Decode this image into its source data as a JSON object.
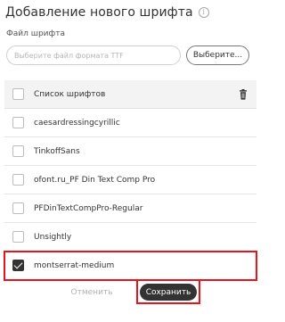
{
  "dialog": {
    "title": "Добавление нового шрифта",
    "info_icon": "ⓘ"
  },
  "file_field": {
    "label": "Файл шрифта",
    "placeholder": "Выберите файл формата TTF",
    "browse_label": "Выберите..."
  },
  "font_list": {
    "header_label": "Список шрифтов",
    "header_icon": "trash-icon",
    "items": [
      {
        "label": "caesardressingcyrillic",
        "checked": false
      },
      {
        "label": "TinkoffSans",
        "checked": false
      },
      {
        "label": "ofont.ru_PF Din Text Comp Pro",
        "checked": false
      },
      {
        "label": "PFDinTextCompPro-Regular",
        "checked": false
      },
      {
        "label": "Unsightly",
        "checked": false
      },
      {
        "label": "montserrat-medium",
        "checked": true
      }
    ]
  },
  "actions": {
    "cancel_label": "Отменить",
    "save_label": "Сохранить"
  },
  "colors": {
    "highlight": "#e8141c",
    "primary_button": "#333333",
    "header_bg": "#f3f3f3"
  }
}
